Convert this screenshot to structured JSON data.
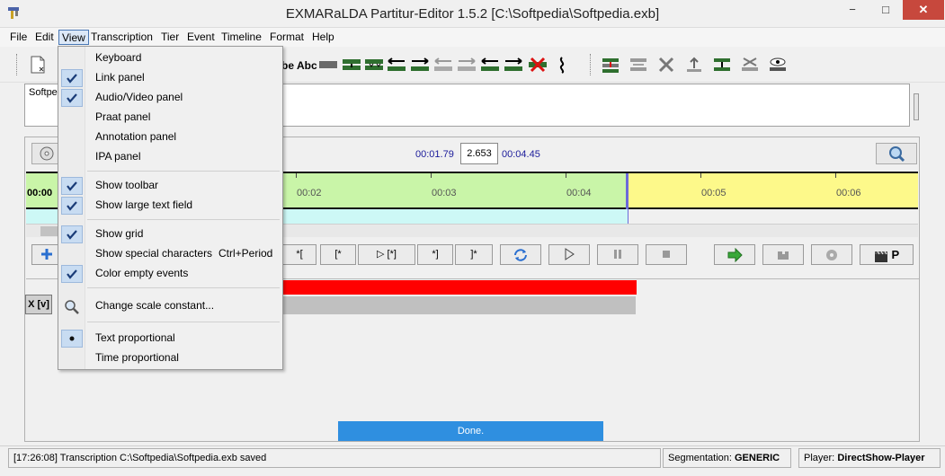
{
  "window": {
    "title": "EXMARaLDA Partitur-Editor 1.5.2 [C:\\Softpedia\\Softpedia.exb]",
    "minimize": "−",
    "maximize": "□",
    "close": "✕"
  },
  "menubar": {
    "items": [
      "File",
      "Edit",
      "View",
      "Transcription",
      "Tier",
      "Event",
      "Timeline",
      "Format",
      "Help"
    ]
  },
  "view_menu": {
    "items": [
      {
        "label": "Keyboard",
        "checked": false
      },
      {
        "label": "Link panel",
        "checked": true
      },
      {
        "label": "Audio/Video panel",
        "checked": true
      },
      {
        "label": "Praat panel",
        "checked": false
      },
      {
        "label": "Annotation panel",
        "checked": false
      },
      {
        "label": "IPA panel",
        "checked": false
      },
      {
        "label": "Show toolbar",
        "checked": true
      },
      {
        "label": "Show large text field",
        "checked": true
      },
      {
        "label": "Show grid",
        "checked": true
      },
      {
        "label": "Show special characters",
        "checked": false,
        "shortcut": "Ctrl+Period"
      },
      {
        "label": "Color empty events",
        "checked": true
      },
      {
        "label": "Change scale constant...",
        "icon": "magnifier-icon"
      },
      {
        "label": "Text proportional",
        "radio": true
      },
      {
        "label": "Time proportional",
        "radio": false
      }
    ]
  },
  "toolbar": {
    "abc_label_1": "be",
    "abc_label_2": "Abc"
  },
  "text_field": {
    "value": "Softpedia"
  },
  "media": {
    "start_time": "00:01.79",
    "scale_value": "2.653",
    "end_time": "00:04.45"
  },
  "ruler": {
    "ticks": [
      "00:00",
      "00:02",
      "00:03",
      "00:04",
      "00:05",
      "00:06"
    ]
  },
  "controls": {
    "b1": "*[",
    "b2": "[*",
    "b3": "▷ [*]",
    "b4": "*]",
    "b5": "]*",
    "praat_label": "P"
  },
  "tier": {
    "label": "X [v]"
  },
  "progress": {
    "text": "Done."
  },
  "status": {
    "message": "[17:26:08] Transcription C:\\Softpedia\\Softpedia.exb saved",
    "segmentation_label": "Segmentation:",
    "segmentation_value": "GENERIC",
    "player_label": "Player:",
    "player_value": "DirectShow-Player"
  },
  "colors": {
    "ruler_green": "#c9f5a8",
    "ruler_yellow": "#fdf98a",
    "event_red": "#ff0000",
    "progress_blue": "#2f8fe0"
  }
}
